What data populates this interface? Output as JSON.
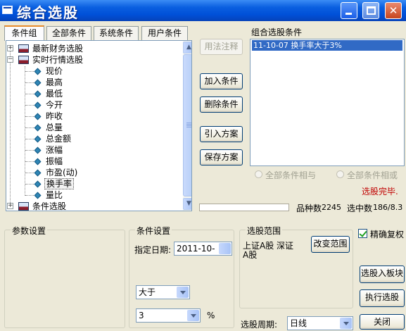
{
  "window": {
    "title": "综合选股"
  },
  "tabs": [
    {
      "label": "条件组",
      "active": true
    },
    {
      "label": "全部条件"
    },
    {
      "label": "系统条件"
    },
    {
      "label": "用户条件"
    }
  ],
  "tree": {
    "root_items": [
      {
        "label": "最新财务选股",
        "expanded": false
      },
      {
        "label": "实时行情选股",
        "expanded": true
      },
      {
        "label": "条件选股",
        "expanded": false
      }
    ],
    "children": [
      "现价",
      "最高",
      "最低",
      "今开",
      "昨收",
      "总量",
      "总金额",
      "涨幅",
      "振幅",
      "市盈(动)",
      "换手率",
      "量比"
    ],
    "selected_child": "换手率"
  },
  "actions": {
    "usage_note": "用法注释",
    "add_condition": "加入条件",
    "delete_condition": "删除条件",
    "import_plan": "引入方案",
    "save_plan": "保存方案"
  },
  "conditions": {
    "header": "组合选股条件",
    "items": [
      "11-10-07 换手率大于3%"
    ],
    "radio_and": "全部条件相与",
    "radio_or": "全部条件相或",
    "status": "选股完毕."
  },
  "stats": {
    "variety_label": "品种数",
    "variety_count": "2245",
    "selected_label": "选中数",
    "selected_value": "186/8.3"
  },
  "param_settings": {
    "title": "参数设置"
  },
  "condition_settings": {
    "title": "条件设置",
    "date_label": "指定日期:",
    "date_value": "2011-10-",
    "compare_value": "大于",
    "threshold_value": "3",
    "unit": "%"
  },
  "stock_range": {
    "title": "选股范围",
    "range_text_1": "上证A股 深证",
    "range_text_2": "A股",
    "change_range": "改变范围",
    "period_label": "选股周期:",
    "period_value": "日线"
  },
  "right_panel": {
    "precise_adjust": "精确复权",
    "precise_checked": true,
    "to_block": "选股入板块",
    "execute": "执行选股",
    "close": "关闭"
  }
}
